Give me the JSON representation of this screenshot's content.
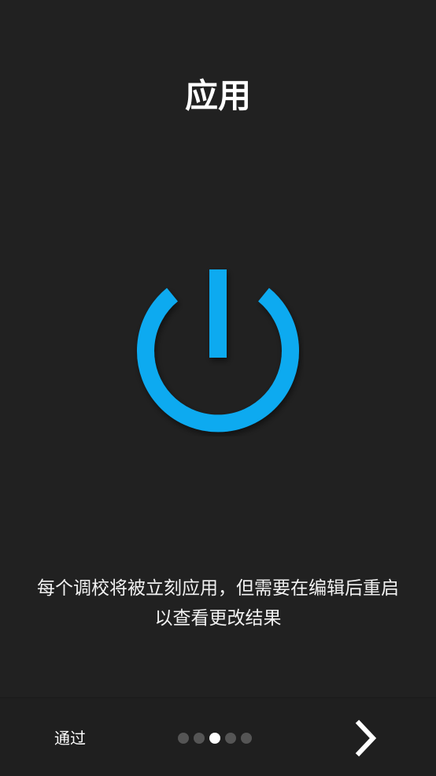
{
  "title": "应用",
  "description_lines": [
    "每个调校将被立刻应用，但需要在编辑后重启",
    "以查看更改结果"
  ],
  "bottom_bar": {
    "skip_label": "通过",
    "page_count": 5,
    "current_page": 3
  },
  "icons": {
    "main": "power-icon",
    "next": "chevron-right-icon"
  },
  "colors": {
    "background": "#212121",
    "accent": "#0AAAF0",
    "text": "#FFFFFF"
  }
}
